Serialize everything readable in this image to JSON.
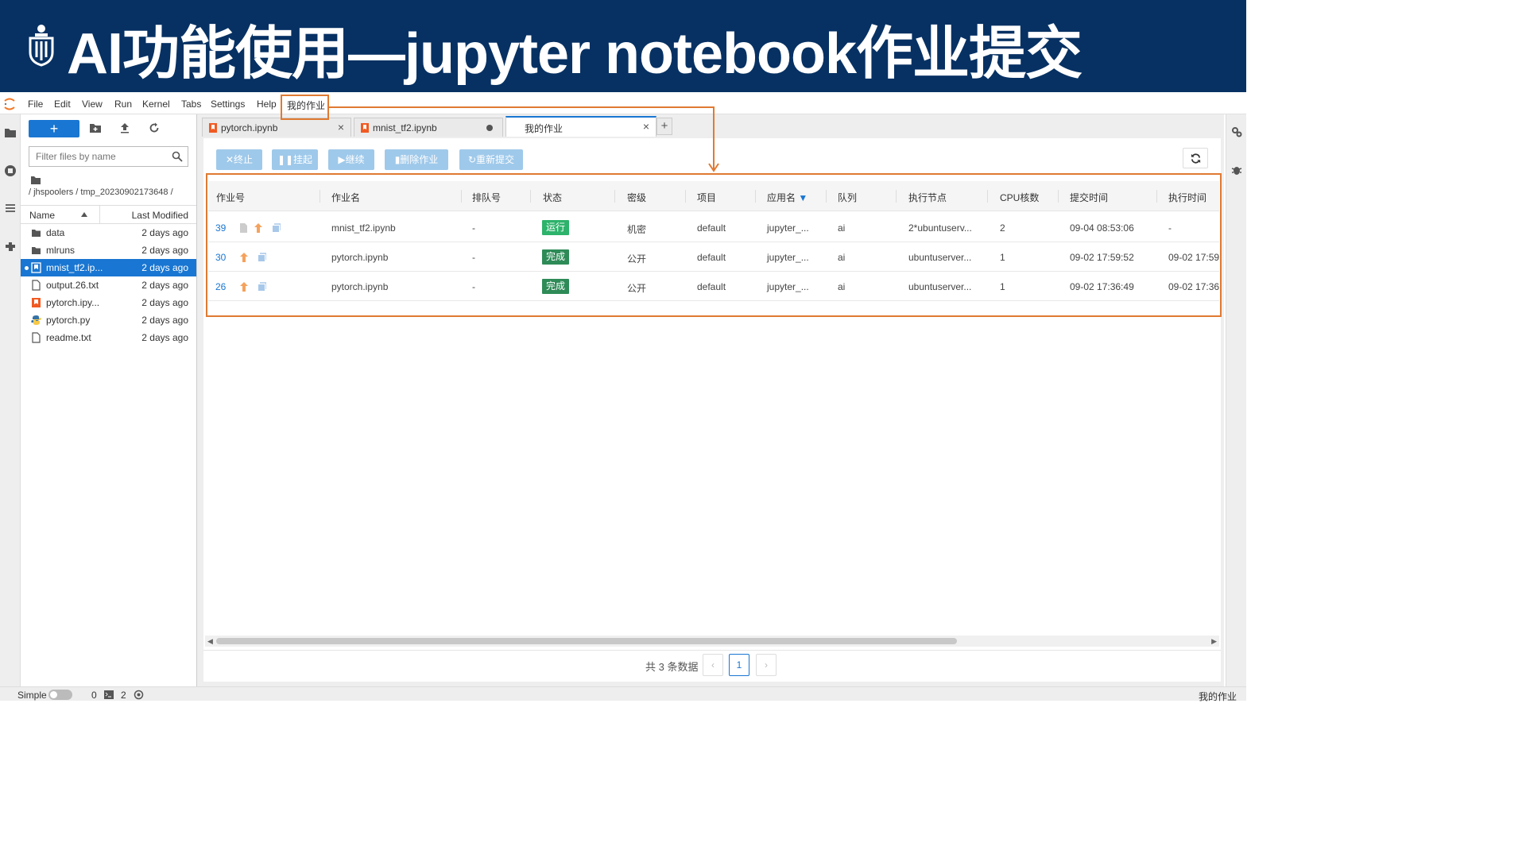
{
  "slide": {
    "title": "AI功能使用—jupyter notebook作业提交",
    "banner_color": "#073163",
    "highlight_color": "#e07a32"
  },
  "menubar": {
    "items": [
      "File",
      "Edit",
      "View",
      "Run",
      "Kernel",
      "Tabs",
      "Settings",
      "Help",
      "我的作业"
    ]
  },
  "left_rail": {
    "icons": [
      "folder-icon",
      "running-icon",
      "toc-icon",
      "extension-icon"
    ]
  },
  "file_browser": {
    "new_button": "+",
    "filter_placeholder": "Filter files by name",
    "breadcrumb": "/ jhspoolers / tmp_20230902173648 /",
    "col_name": "Name",
    "col_modified": "Last Modified",
    "files": [
      {
        "name": "data",
        "modified": "2 days ago",
        "icon": "folder-icon",
        "selected": false
      },
      {
        "name": "mlruns",
        "modified": "2 days ago",
        "icon": "folder-icon",
        "selected": false
      },
      {
        "name": "mnist_tf2.ip...",
        "modified": "2 days ago",
        "icon": "notebook-icon",
        "selected": true
      },
      {
        "name": "output.26.txt",
        "modified": "2 days ago",
        "icon": "file-icon",
        "selected": false
      },
      {
        "name": "pytorch.ipy...",
        "modified": "2 days ago",
        "icon": "notebook-icon",
        "selected": false
      },
      {
        "name": "pytorch.py",
        "modified": "2 days ago",
        "icon": "python-icon",
        "selected": false
      },
      {
        "name": "readme.txt",
        "modified": "2 days ago",
        "icon": "file-icon",
        "selected": false
      }
    ]
  },
  "tabs": [
    {
      "label": "pytorch.ipynb",
      "icon": "notebook-icon",
      "state": "close",
      "active": false
    },
    {
      "label": "mnist_tf2.ipynb",
      "icon": "notebook-icon",
      "state": "dirty",
      "active": false
    },
    {
      "label": "我的作业",
      "icon": "",
      "state": "close",
      "active": true
    }
  ],
  "toolbar": {
    "stop": "终止",
    "suspend": "挂起",
    "resume": "继续",
    "delete": "删除作业",
    "resubmit": "重新提交"
  },
  "job_table": {
    "headers": [
      "作业号",
      "作业名",
      "排队号",
      "状态",
      "密级",
      "项目",
      "应用名",
      "队列",
      "执行节点",
      "CPU核数",
      "提交时间",
      "执行时间"
    ],
    "rows": [
      {
        "id": "39",
        "name": "mnist_tf2.ipynb",
        "queue_no": "-",
        "status": "运行",
        "status_color": "#2db36b",
        "level": "机密",
        "project": "default",
        "app": "jupyter_...",
        "queue": "ai",
        "node": "2*ubuntuserv...",
        "cpus": "2",
        "submit_time": "09-04 08:53:06",
        "exec_time": "-"
      },
      {
        "id": "30",
        "name": "pytorch.ipynb",
        "queue_no": "-",
        "status": "完成",
        "status_color": "#2e8b57",
        "level": "公开",
        "project": "default",
        "app": "jupyter_...",
        "queue": "ai",
        "node": "ubuntuserver...",
        "cpus": "1",
        "submit_time": "09-02 17:59:52",
        "exec_time": "09-02 17:59"
      },
      {
        "id": "26",
        "name": "pytorch.ipynb",
        "queue_no": "-",
        "status": "完成",
        "status_color": "#2e8b57",
        "level": "公开",
        "project": "default",
        "app": "jupyter_...",
        "queue": "ai",
        "node": "ubuntuserver...",
        "cpus": "1",
        "submit_time": "09-02 17:36:49",
        "exec_time": "09-02 17:36"
      }
    ]
  },
  "pagination": {
    "total": "共 3 条数据",
    "prev": "‹",
    "current": "1",
    "next": "›"
  },
  "statusbar": {
    "simple": "Simple",
    "count_a": "0",
    "count_b": "2",
    "right_label": "我的作业"
  }
}
